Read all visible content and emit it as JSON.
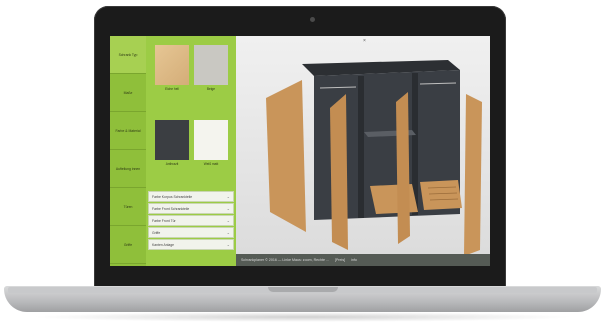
{
  "sidebar": {
    "items": [
      {
        "label": "Schrank Typ"
      },
      {
        "label": "Maße"
      },
      {
        "label": "Farbe & Material"
      },
      {
        "label": "Aufteilung innen"
      },
      {
        "label": "Türen"
      },
      {
        "label": "Griffe"
      }
    ]
  },
  "materials": [
    {
      "label": "Eiche hell"
    },
    {
      "label": "Beige"
    },
    {
      "label": "Anthrazit"
    },
    {
      "label": "Weiß matt"
    }
  ],
  "dropdowns": [
    {
      "label": "Farbe Korpus Schrankteile"
    },
    {
      "label": "Farbe Front Schrankteile"
    },
    {
      "label": "Farbe Front Tür"
    },
    {
      "label": "Griffe"
    },
    {
      "label": "Kanten Anlage"
    }
  ],
  "viewport": {
    "close_label": "×"
  },
  "status": {
    "text": "Schrankplaner © 2016 — Linke Maus: zoom, Rechte ...",
    "extra": "[Preis]",
    "extra2": "info"
  },
  "colors": {
    "sidebar": "#8fbf3a",
    "panel": "#9ccc45",
    "cabinet_body": "#3a3e44",
    "wood": "#c9955a"
  }
}
